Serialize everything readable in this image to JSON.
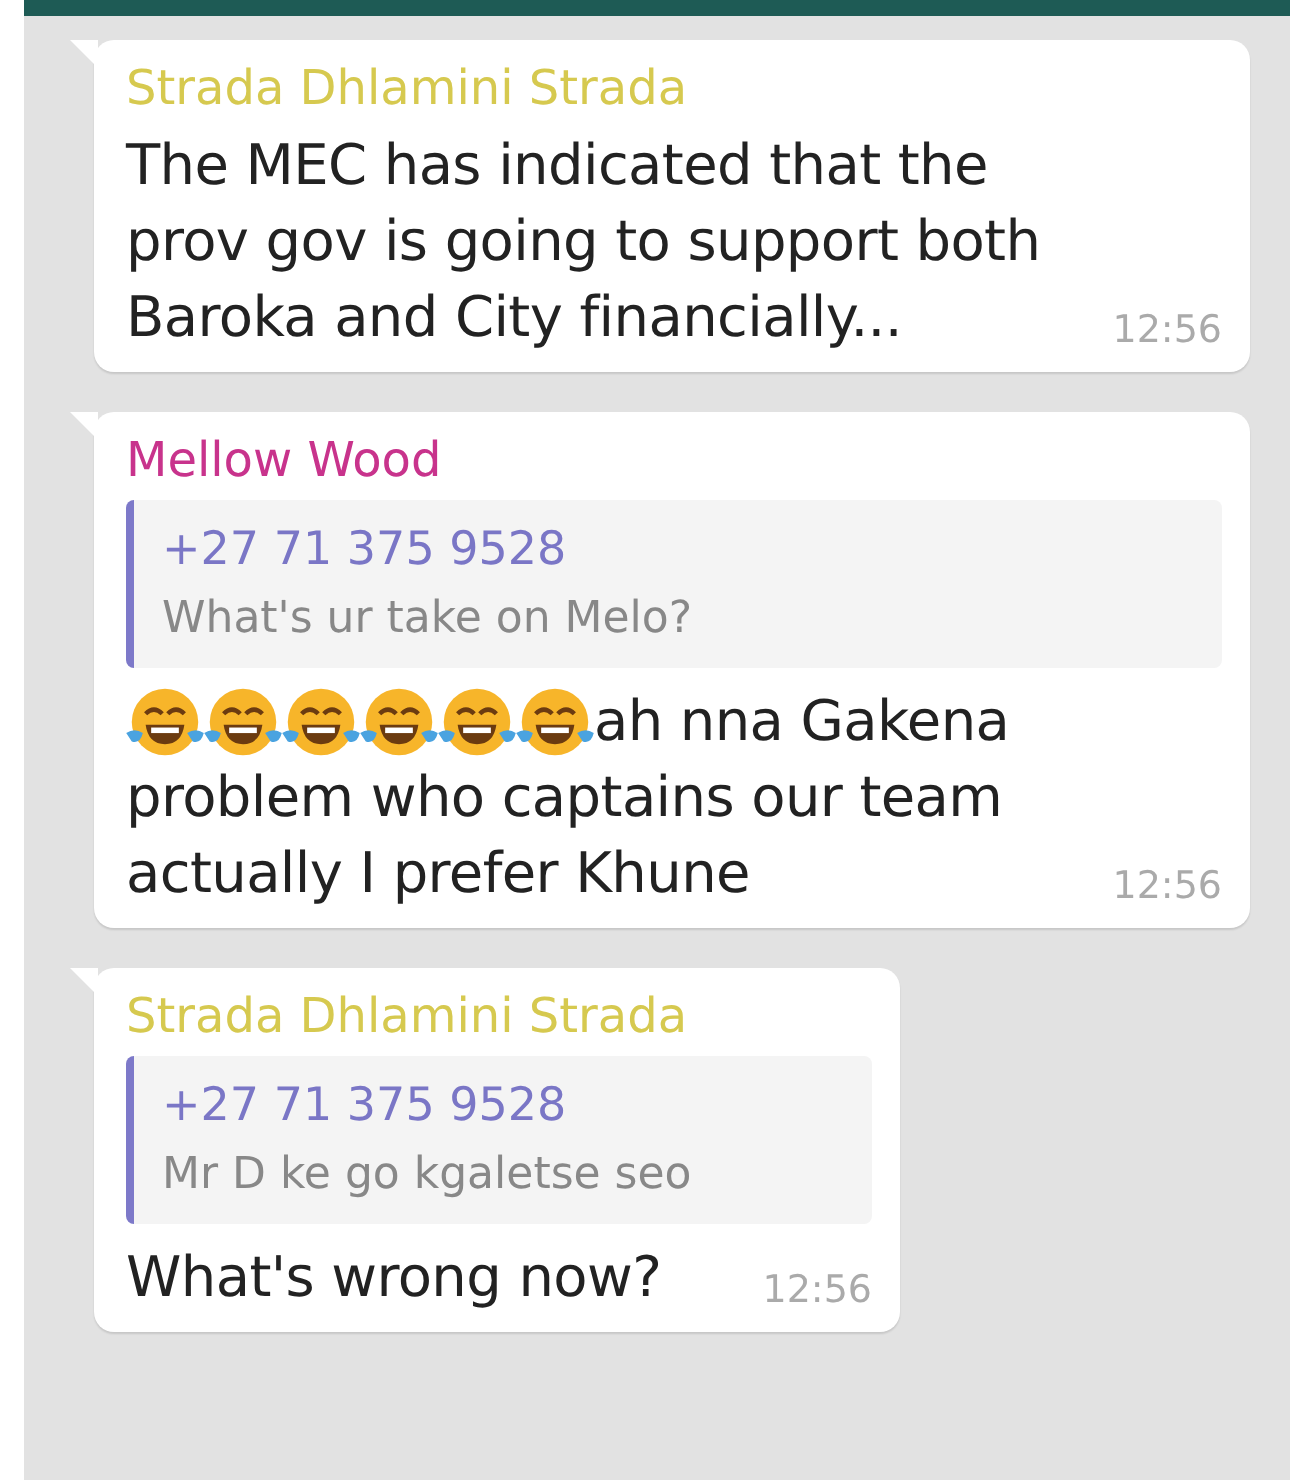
{
  "messages": [
    {
      "sender": "Strada Dhlamini Strada",
      "color": "#d6c94f",
      "text": "The MEC has indicated that the prov gov is going to support both Baroka and City financially...",
      "time": "12:56"
    },
    {
      "sender": "Mellow Wood",
      "color": "#c8338c",
      "quote": {
        "author": "+27 71 375 9528",
        "text": "What's ur take on Melo?"
      },
      "emojis": [
        {
          "kind": "tears-of-joy"
        },
        {
          "kind": "tears-of-joy"
        },
        {
          "kind": "tears-of-joy"
        },
        {
          "kind": "tears-of-joy"
        },
        {
          "kind": "tears-of-joy"
        },
        {
          "kind": "tears-of-joy"
        }
      ],
      "text": "ah nna Gakena",
      "text_continued": "problem who captains our team actually I prefer Khune",
      "time": "12:56"
    },
    {
      "sender": "Strada Dhlamini Strada",
      "color": "#d6c94f",
      "quote": {
        "author": "+27 71 375 9528",
        "text": "Mr D ke go kgaletse seo"
      },
      "text": "What's wrong now?",
      "time": "12:56",
      "compact": true
    }
  ]
}
